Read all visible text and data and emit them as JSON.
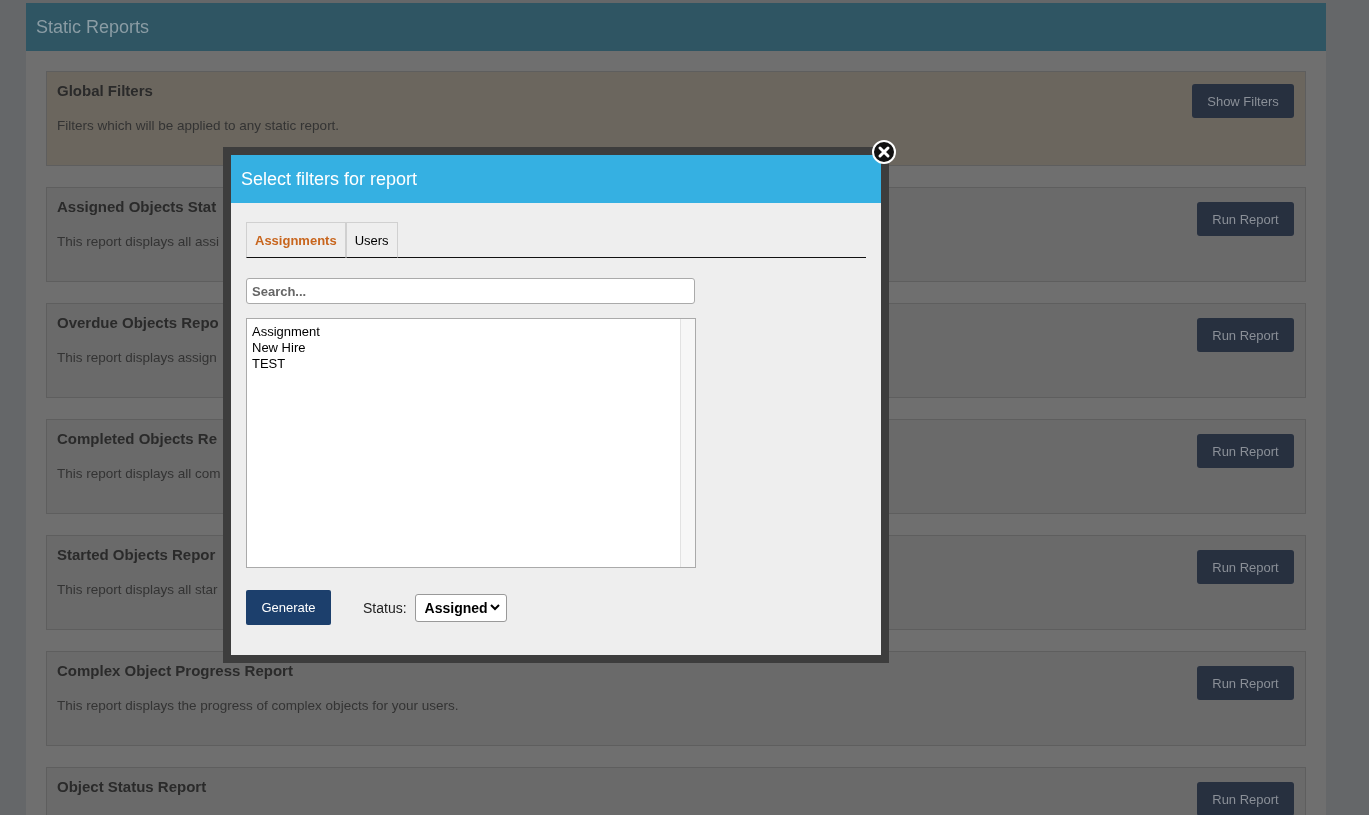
{
  "page": {
    "title": "Static Reports"
  },
  "reports": [
    {
      "kind": "filters",
      "title": "Global Filters",
      "description": "Filters which will be applied to any static report.",
      "button": "Show Filters"
    },
    {
      "kind": "report",
      "title": "Assigned Objects Stat",
      "description": "This report displays all assi",
      "button": "Run Report"
    },
    {
      "kind": "report",
      "title": "Overdue Objects Repo",
      "description": "This report displays assign",
      "button": "Run Report"
    },
    {
      "kind": "report",
      "title": "Completed Objects Re",
      "description": "This report displays all com",
      "button": "Run Report"
    },
    {
      "kind": "report",
      "title": "Started Objects Repor",
      "description": "This report displays all star",
      "button": "Run Report"
    },
    {
      "kind": "report",
      "title": "Complex Object Progress Report",
      "description": "This report displays the progress of complex objects for your users.",
      "button": "Run Report"
    },
    {
      "kind": "report",
      "title": "Object Status Report",
      "button": "Run Report"
    }
  ],
  "modal": {
    "title": "Select filters for report",
    "tabs": [
      {
        "label": "Assignments",
        "selected": true
      },
      {
        "label": "Users",
        "selected": false
      }
    ],
    "search": {
      "placeholder": "Search..."
    },
    "list_items": [
      "Assignment",
      "New Hire",
      "TEST"
    ],
    "generate_button": "Generate",
    "status": {
      "label": "Status:",
      "value": "Assigned"
    }
  }
}
